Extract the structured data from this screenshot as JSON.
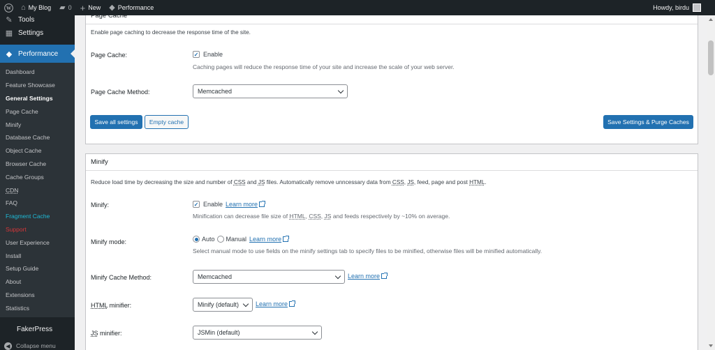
{
  "adminbar": {
    "site_name": "My Blog",
    "comments_count": "0",
    "new_label": "New",
    "performance_label": "Performance",
    "greeting": "Howdy, birdu"
  },
  "sidebar": {
    "tools_label": "Tools",
    "settings_label": "Settings",
    "performance_label": "Performance",
    "submenu": [
      {
        "label": "Dashboard"
      },
      {
        "label": "Feature Showcase"
      },
      {
        "label": "General Settings"
      },
      {
        "label": "Page Cache"
      },
      {
        "label": "Minify"
      },
      {
        "label": "Database Cache"
      },
      {
        "label": "Object Cache"
      },
      {
        "label": "Browser Cache"
      },
      {
        "label": "Cache Groups"
      },
      {
        "label": "CDN"
      },
      {
        "label": "FAQ"
      },
      {
        "label": "Fragment Cache"
      },
      {
        "label": "Support"
      },
      {
        "label": "User Experience"
      },
      {
        "label": "Install"
      },
      {
        "label": "Setup Guide"
      },
      {
        "label": "About"
      },
      {
        "label": "Extensions"
      },
      {
        "label": "Statistics"
      }
    ],
    "fakerpress_label": "FakerPress",
    "collapse_label": "Collapse menu"
  },
  "page_cache_box": {
    "title": "Page Cache",
    "description": "Enable page caching to decrease the response time of the site.",
    "page_cache_label": "Page Cache:",
    "enable_label": "Enable",
    "enable_note": "Caching pages will reduce the response time of your site and increase the scale of your web server.",
    "method_label": "Page Cache Method:",
    "method_value": "Memcached",
    "save_all_label": "Save all settings",
    "empty_cache_label": "Empty cache",
    "save_purge_label": "Save Settings & Purge Caches"
  },
  "minify_box": {
    "title": "Minify",
    "desc_1": "Reduce load time by decreasing the size and number of ",
    "desc_css": "CSS",
    "desc_2": " and ",
    "desc_js": "JS",
    "desc_3": " files. Automatically remove unncessary data from ",
    "desc_css2": "CSS",
    "desc_4": ", ",
    "desc_js2": "JS",
    "desc_5": ", feed, page and post ",
    "desc_html": "HTML",
    "desc_6": ".",
    "minify_label": "Minify:",
    "enable_label": "Enable",
    "learn_more": "Learn more",
    "minify_note_1": "Minification can decrease file size of ",
    "minify_note_html": "HTML",
    "minify_note_2": ", ",
    "minify_note_css": "CSS",
    "minify_note_3": ", ",
    "minify_note_js": "JS",
    "minify_note_4": " and feeds respectively by ~10% on average.",
    "mode_label": "Minify mode:",
    "mode_auto": "Auto",
    "mode_manual": "Manual",
    "mode_note": "Select manual mode to use fields on the minify settings tab to specify files to be minified, otherwise files will be minified automatically.",
    "cache_method_label": "Minify Cache Method:",
    "cache_method_value": "Memcached",
    "html_minifier_abbr": "HTML",
    "html_minifier_label": " minifier:",
    "html_minifier_value": "Minify (default)",
    "js_minifier_abbr": "JS",
    "js_minifier_label": " minifier:",
    "js_minifier_value": "JSMin (default)"
  },
  "colors": {
    "accent": "#2271b1",
    "adminbar_bg": "#1d2327",
    "fragment_cache": "#1ebad6",
    "support": "#d63638"
  }
}
